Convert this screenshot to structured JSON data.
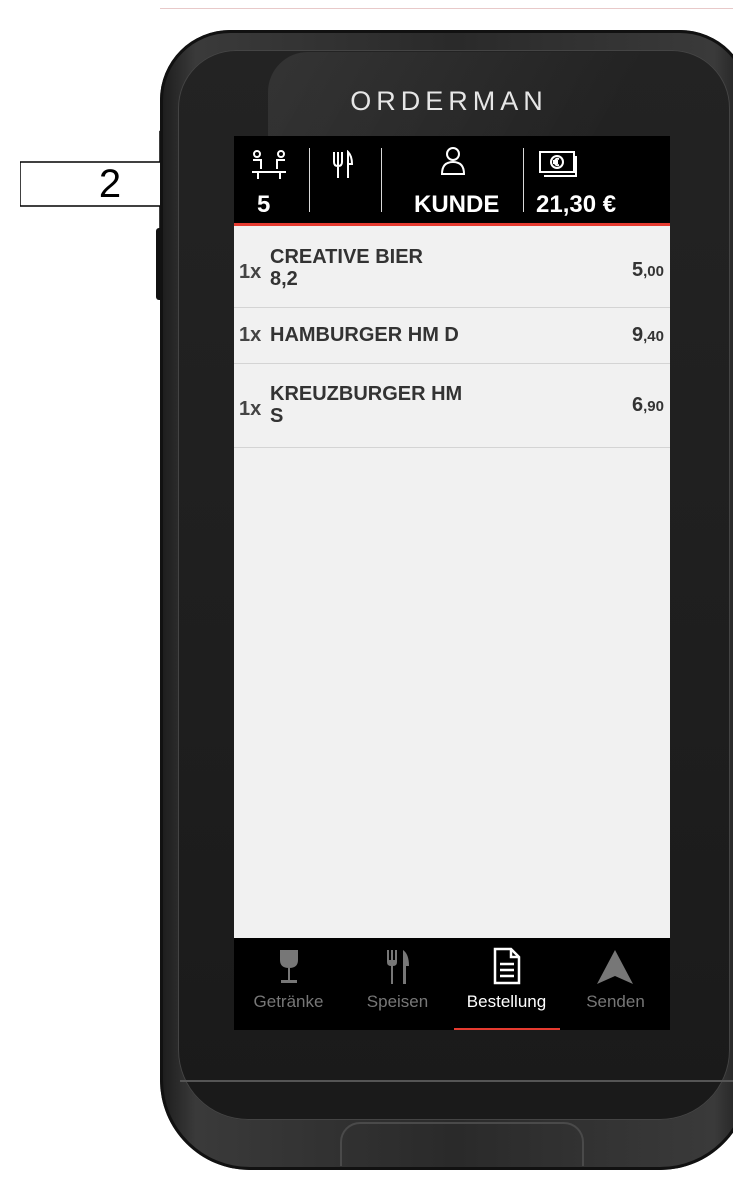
{
  "brand": "ORDERMAN",
  "annotation": {
    "label": "2"
  },
  "header": {
    "table_value": "5",
    "customer_label": "KUNDE",
    "total": "21,30 €",
    "accent_color": "#e63b30"
  },
  "order_items": [
    {
      "qty": "1x",
      "name": "CREATIVE BIER\n8,2",
      "price_main": "5",
      "price_cents": ",00"
    },
    {
      "qty": "1x",
      "name": "HAMBURGER HM D",
      "price_main": "9",
      "price_cents": ",40"
    },
    {
      "qty": "1x",
      "name": "KREUZBURGER HM\nS",
      "price_main": "6",
      "price_cents": ",90"
    }
  ],
  "tabs": [
    {
      "label": "Getränke",
      "icon": "wine-glass-icon"
    },
    {
      "label": "Speisen",
      "icon": "cutlery-icon"
    },
    {
      "label": "Bestellung",
      "icon": "document-icon"
    },
    {
      "label": "Senden",
      "icon": "send-arrow-icon"
    }
  ],
  "active_tab": "Bestellung"
}
